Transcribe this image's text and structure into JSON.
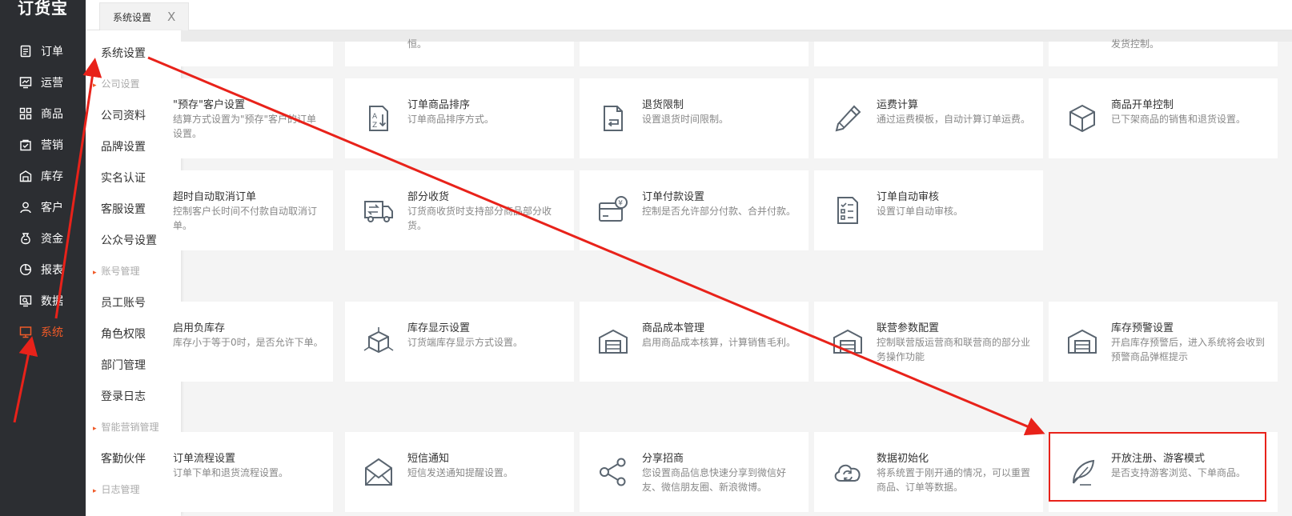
{
  "app": {
    "logo": "订货宝"
  },
  "nav": {
    "items": [
      {
        "label": "订单",
        "icon": "order-icon"
      },
      {
        "label": "运营",
        "icon": "operations-icon"
      },
      {
        "label": "商品",
        "icon": "product-icon"
      },
      {
        "label": "营销",
        "icon": "marketing-icon"
      },
      {
        "label": "库存",
        "icon": "inventory-icon"
      },
      {
        "label": "客户",
        "icon": "customer-icon"
      },
      {
        "label": "资金",
        "icon": "money-bag-icon"
      },
      {
        "label": "报表",
        "icon": "report-icon"
      },
      {
        "label": "数据",
        "icon": "data-icon"
      },
      {
        "label": "系统",
        "icon": "system-icon",
        "active": true
      }
    ]
  },
  "submenu": {
    "title": "系统设置",
    "group_company": "公司设置",
    "company_info": "公司资料",
    "brand": "品牌设置",
    "realname": "实名认证",
    "service": "客服设置",
    "wechat": "公众号设置",
    "group_account": "账号管理",
    "staff": "员工账号",
    "roles": "角色权限",
    "department": "部门管理",
    "login_log": "登录日志",
    "group_marketing": "智能营销管理",
    "partner": "客勤伙伴",
    "group_log": "日志管理"
  },
  "tabs": [
    {
      "label": "系统设置",
      "close": "X"
    }
  ],
  "top_partial": {
    "c1": "恒。",
    "c5": "发货控制。"
  },
  "cards": {
    "r1c1": {
      "title": "\"预存\"客户设置",
      "desc": "结算方式设置为\"预存\"客户的订单设置。"
    },
    "r1c2": {
      "title": "订单商品排序",
      "desc": "订单商品排序方式。",
      "icon": "sort-az-icon"
    },
    "r1c3": {
      "title": "退货限制",
      "desc": "设置退货时间限制。",
      "icon": "return-doc-icon"
    },
    "r1c4": {
      "title": "运费计算",
      "desc": "通过运费模板，自动计算订单运费。",
      "icon": "pen-icon"
    },
    "r1c5": {
      "title": "商品开单控制",
      "desc": "已下架商品的销售和退货设置。",
      "icon": "box-icon"
    },
    "r2c1": {
      "title": "超时自动取消订单",
      "desc": "控制客户长时间不付款自动取消订单。"
    },
    "r2c2": {
      "title": "部分收货",
      "desc": "订货商收货时支持部分商品部分收货。",
      "icon": "truck-icon"
    },
    "r2c3": {
      "title": "订单付款设置",
      "desc": "控制是否允许部分付款、合并付款。",
      "icon": "payment-card-icon"
    },
    "r2c4": {
      "title": "订单自动审核",
      "desc": "设置订单自动审核。",
      "icon": "checklist-icon"
    },
    "r3c1": {
      "title": "启用负库存",
      "desc": "库存小于等于0时，是否允许下单。"
    },
    "r3c2": {
      "title": "库存显示设置",
      "desc": "订货端库存显示方式设置。",
      "icon": "cube-icon"
    },
    "r3c3": {
      "title": "商品成本管理",
      "desc": "启用商品成本核算，计算销售毛利。",
      "icon": "warehouse-icon"
    },
    "r3c4": {
      "title": "联营参数配置",
      "desc": "控制联营版运营商和联营商的部分业务操作功能",
      "icon": "warehouse-icon"
    },
    "r3c5": {
      "title": "库存预警设置",
      "desc": "开启库存预警后，进入系统将会收到预警商品弹框提示",
      "icon": "warehouse-icon"
    },
    "r4c1": {
      "title": "订单流程设置",
      "desc": "订单下单和退货流程设置。"
    },
    "r4c2": {
      "title": "短信通知",
      "desc": "短信发送通知提醒设置。",
      "icon": "envelope-icon"
    },
    "r4c3": {
      "title": "分享招商",
      "desc": "您设置商品信息快速分享到微信好友、微信朋友圈、新浪微博。",
      "icon": "share-icon"
    },
    "r4c4": {
      "title": "数据初始化",
      "desc": "将系统置于刚开通的情况，可以重置商品、订单等数据。",
      "icon": "cloud-sync-icon"
    },
    "r4c5": {
      "title": "开放注册、游客模式",
      "desc": "是否支持游客浏览、下单商品。",
      "icon": "feather-icon"
    }
  },
  "colors": {
    "nav_bg": "#2c2e32",
    "accent": "#f05a28",
    "annotation_red": "#e8221a"
  }
}
